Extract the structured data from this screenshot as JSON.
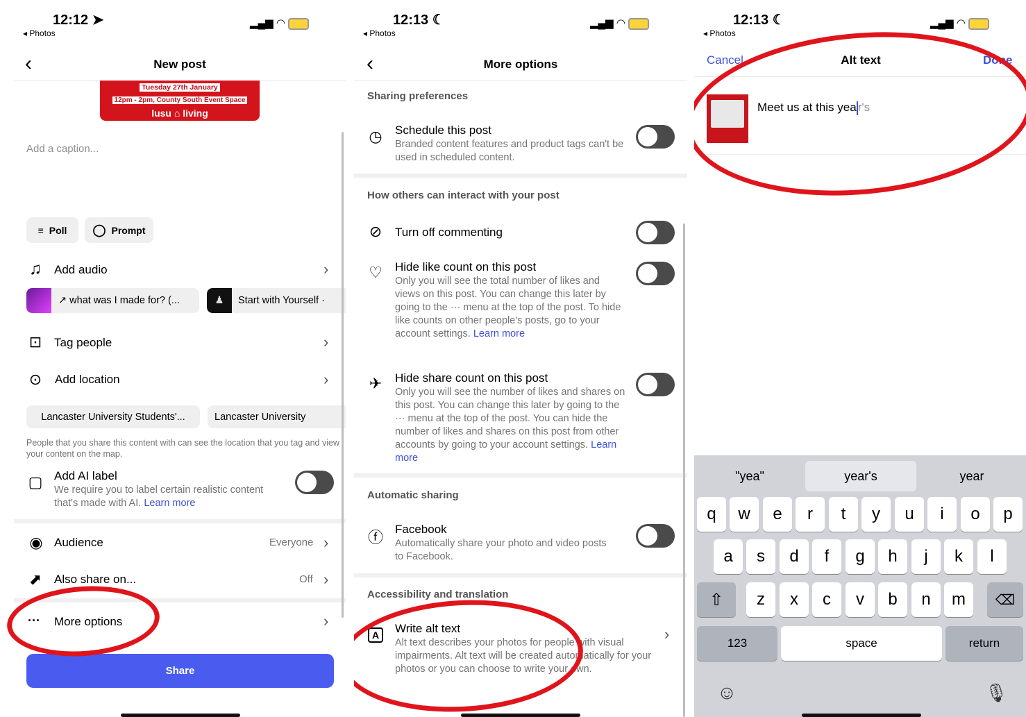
{
  "screen1": {
    "time": "12:12",
    "back_app": "◂ Photos",
    "title": "New post",
    "thumb": {
      "line1": "Tuesday 27th January",
      "line2": "12pm - 2pm, County South Event Space",
      "brand": "lusu ⌂ living"
    },
    "caption_placeholder": "Add a caption...",
    "poll": "Poll",
    "prompt": "Prompt",
    "add_audio": "Add audio",
    "song1": "↗ what was I made for? (...",
    "song2": "Start with Yourself ·",
    "tag_people": "Tag people",
    "add_location": "Add location",
    "loc1": "Lancaster University Students'...",
    "loc2": "Lancaster University",
    "location_note": "People that you share this content with can see the location that you tag and view your content on the map.",
    "ai_label": "Add AI label",
    "ai_sub": "We require you to label certain realistic content that's made with AI.",
    "learn_more": "Learn more",
    "audience": "Audience",
    "audience_value": "Everyone",
    "also_share": "Also share on...",
    "also_share_value": "Off",
    "more_options": "More options",
    "share": "Share"
  },
  "screen2": {
    "time": "12:13",
    "back_app": "◂ Photos",
    "title": "More options",
    "sharing_prefs": "Sharing preferences",
    "schedule": "Schedule this post",
    "schedule_sub": "Branded content features and product tags can't be used in scheduled content.",
    "how_others": "How others can interact with your post",
    "turn_off_commenting": "Turn off commenting",
    "hide_like": "Hide like count on this post",
    "hide_like_sub": "Only you will see the total number of likes and views on this post. You can change this later by going to the ··· menu at the top of the post. To hide like counts on other people's posts, go to your account settings.",
    "hide_like_link": "Learn more",
    "hide_share": "Hide share count on this post",
    "hide_share_sub": "Only you will see the number of likes and shares on this post. You can change this later by going to the ··· menu at the top of the post. You can hide the number of likes and shares on this post from other accounts by going to your account settings.",
    "hide_share_link": "Learn more",
    "automatic_sharing": "Automatic sharing",
    "facebook": "Facebook",
    "facebook_sub": "Automatically share your photo and video posts to Facebook.",
    "accessibility": "Accessibility and translation",
    "write_alt": "Write alt text",
    "write_alt_sub": "Alt text describes your photos for people with visual impairments. Alt text will be created automatically for your photos or you can choose to write your own."
  },
  "screen3": {
    "time": "12:13",
    "back_app": "◂ Photos",
    "cancel": "Cancel",
    "title": "Alt text",
    "done": "Done",
    "alt_value_before": "Meet us at this yea",
    "alt_value_after": "r's",
    "suggestions": [
      "\"yea\"",
      "year's",
      "year"
    ],
    "row1": [
      "q",
      "w",
      "e",
      "r",
      "t",
      "y",
      "u",
      "i",
      "o",
      "p"
    ],
    "row2": [
      "a",
      "s",
      "d",
      "f",
      "g",
      "h",
      "j",
      "k",
      "l"
    ],
    "row3": [
      "z",
      "x",
      "c",
      "v",
      "b",
      "n",
      "m"
    ],
    "key_123": "123",
    "key_space": "space",
    "key_return": "return"
  },
  "colors": {
    "accent": "#3f51d9",
    "share_button": "#4a5cf0",
    "annotation": "#e0141b",
    "toggle_off": "#4a4a4a"
  }
}
